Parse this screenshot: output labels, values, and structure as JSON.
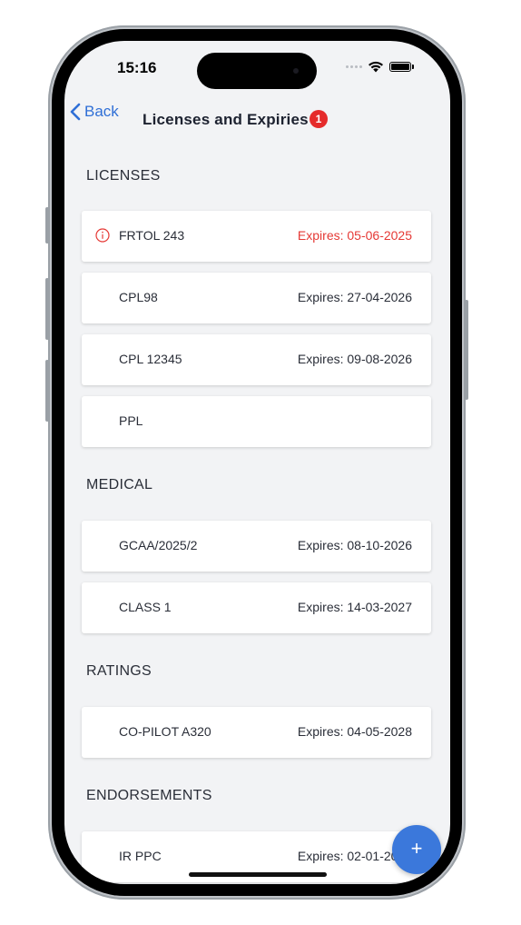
{
  "status_bar": {
    "time": "15:16"
  },
  "nav": {
    "back_label": "Back",
    "title": "Licenses and Expiries",
    "badge_count": "1"
  },
  "sections": {
    "licenses": {
      "title": "LICENSES",
      "items": [
        {
          "name": "FRTOL 243",
          "expiry": "Expires: 05-06-2025",
          "alert": true
        },
        {
          "name": "CPL98",
          "expiry": "Expires: 27-04-2026"
        },
        {
          "name": "CPL 12345",
          "expiry": "Expires: 09-08-2026"
        },
        {
          "name": "PPL",
          "expiry": ""
        }
      ]
    },
    "medical": {
      "title": "MEDICAL",
      "items": [
        {
          "name": "GCAA/2025/2",
          "expiry": "Expires: 08-10-2026"
        },
        {
          "name": "CLASS 1",
          "expiry": "Expires: 14-03-2027"
        }
      ]
    },
    "ratings": {
      "title": "RATINGS",
      "items": [
        {
          "name": "CO-PILOT A320",
          "expiry": "Expires: 04-05-2028"
        }
      ]
    },
    "endorsements": {
      "title": "ENDORSEMENTS",
      "items": [
        {
          "name": "IR PPC",
          "expiry": "Expires: 02-01-2029"
        }
      ]
    }
  },
  "fab": {
    "label": "+"
  },
  "colors": {
    "accent": "#2f6fd6",
    "alert": "#e53935",
    "badge": "#e52b2b",
    "fab": "#3b78db",
    "background": "#f2f3f5"
  },
  "icons": {
    "back": "chevron-left-icon",
    "alert": "info-circle-icon",
    "wifi": "wifi-icon",
    "battery": "battery-icon",
    "signal": "signal-icon"
  }
}
